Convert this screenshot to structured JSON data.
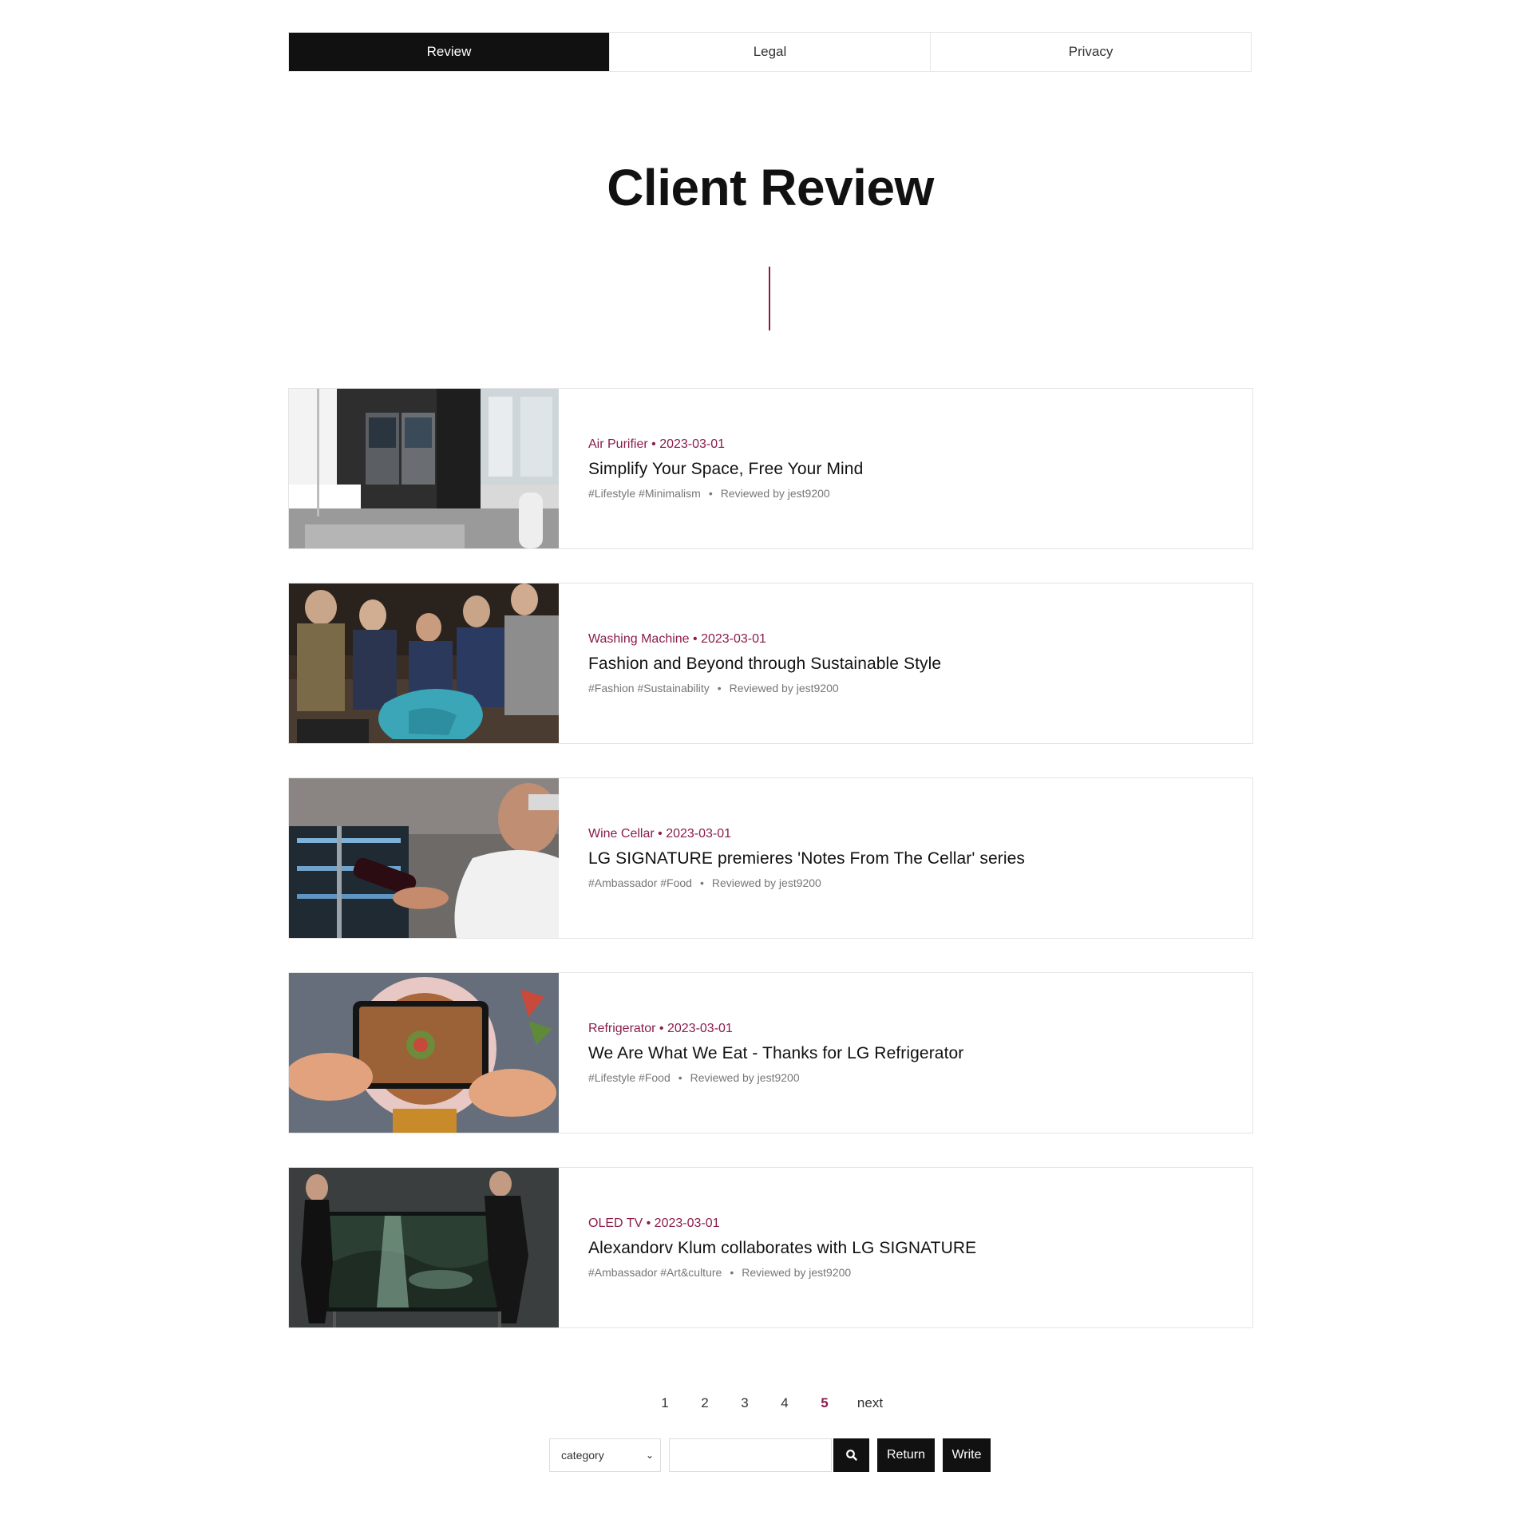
{
  "tabs": [
    {
      "label": "Review",
      "active": true
    },
    {
      "label": "Legal",
      "active": false
    },
    {
      "label": "Privacy",
      "active": false
    }
  ],
  "page": {
    "title": "Client Review",
    "accent_color": "#8a1c4a"
  },
  "reviews": [
    {
      "category": "Air Purifier",
      "date": "2023-03-01",
      "title": "Simplify Your Space, Free Your Mind",
      "tags": "#Lifestyle #Minimalism",
      "reviewer": "Reviewed by jest9200",
      "image": "modern-kitchen-with-refrigerator-and-air-purifier"
    },
    {
      "category": "Washing Machine",
      "date": "2023-03-01",
      "title": "Fashion and Beyond through Sustainable Style",
      "tags": "#Fashion #Sustainability",
      "reviewer": "Reviewed by jest9200",
      "image": "group-of-people-examining-fabric"
    },
    {
      "category": "Wine Cellar",
      "date": "2023-03-01",
      "title": "LG SIGNATURE premieres 'Notes From The Cellar' series",
      "tags": "#Ambassador #Food",
      "reviewer": "Reviewed by jest9200",
      "image": "man-holding-wine-bottle-at-cellar"
    },
    {
      "category": "Refrigerator",
      "date": "2023-03-01",
      "title": "We Are What We Eat - Thanks for LG Refrigerator",
      "tags": "#Lifestyle #Food",
      "reviewer": "Reviewed by jest9200",
      "image": "hands-photographing-galette-with-phone"
    },
    {
      "category": "OLED TV",
      "date": "2023-03-01",
      "title": "Alexandorv Klum collaborates with LG SIGNATURE",
      "tags": "#Ambassador #Art&culture",
      "reviewer": "Reviewed by jest9200",
      "image": "two-people-posing-beside-oled-tv"
    }
  ],
  "pagination": {
    "pages": [
      "1",
      "2",
      "3",
      "4",
      "5"
    ],
    "current": "5",
    "next_label": "next"
  },
  "search": {
    "category_value": "category",
    "input_value": "",
    "search_icon": "search-icon",
    "return_label": "Return",
    "write_label": "Write"
  }
}
